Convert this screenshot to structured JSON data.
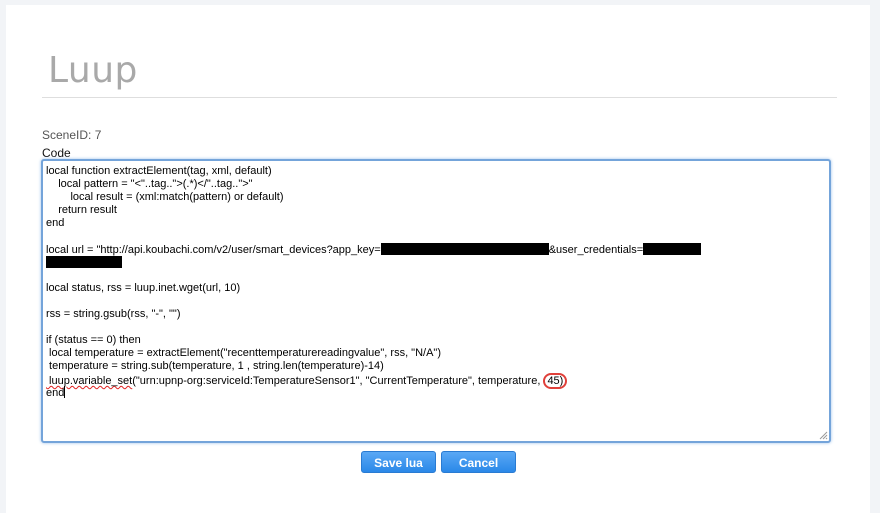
{
  "page": {
    "title": "Luup",
    "scene_id": "SceneID: 7",
    "code_label": "Code"
  },
  "code": {
    "lines": [
      "local function extractElement(tag, xml, default)",
      "    local pattern = \"<\"..tag..\">(.*)</\"..tag..\">\"",
      "        local result = (xml:match(pattern) or default)",
      "    return result",
      "end",
      "",
      "local url = \"http://api.koubachi.com/v2/user/smart_devices?app_key=",
      "&user_credentials=",
      "",
      "local status, rss = luup.inet.wget(url, 10)",
      "",
      "rss = string.gsub(rss, \"-\", \"\")",
      "",
      "if (status == 0) then",
      " local temperature = extractElement(\"recenttemperaturereadingvalue\", rss, \"N/A\")",
      " temperature = string.sub(temperature, 1 , string.len(temperature)-14)",
      " luup.variable_set",
      "(\"urn:upnp-org:serviceId:TemperatureSensor1\", \"CurrentTemperature\", temperature, ",
      "45)",
      "end"
    ]
  },
  "buttons": {
    "save_label": "Save lua",
    "cancel_label": "Cancel"
  },
  "colors": {
    "accent": "#2a88e8",
    "title": "#a9a9a9",
    "highlight_circle": "#e0403a"
  }
}
